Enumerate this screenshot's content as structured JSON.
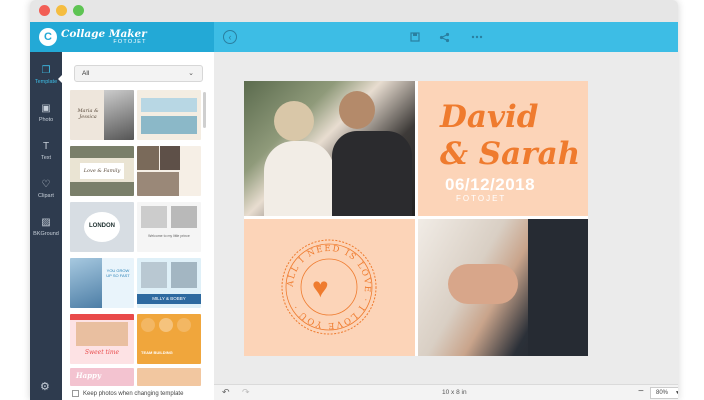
{
  "app": {
    "logo_main": "Collage Maker",
    "logo_sub": "FOTOJET",
    "logo_mark": "C"
  },
  "topbar": {
    "back_icon": "back-arrow-icon",
    "save_icon": "save-icon",
    "share_icon": "share-icon",
    "more_icon": "more-icon"
  },
  "sidebar": {
    "items": [
      {
        "id": "template",
        "label": "Template",
        "glyph": "❐"
      },
      {
        "id": "photo",
        "label": "Photo",
        "glyph": "▣"
      },
      {
        "id": "text",
        "label": "Text",
        "glyph": "T"
      },
      {
        "id": "clipart",
        "label": "Clipart",
        "glyph": "♡"
      },
      {
        "id": "bkground",
        "label": "BKGround",
        "glyph": "▨"
      }
    ],
    "settings_glyph": "⚙"
  },
  "panel": {
    "filter_value": "All",
    "keep_photos_label": "Keep photos when changing template",
    "template_texts": {
      "t1": "Maria & Jessica",
      "t4": "Love & Family",
      "t5": "LONDON",
      "t6": "Welcome to my little prince",
      "t7": "YOU GROW UP SO FAST",
      "t8": "MILLY & BOBBY",
      "t9": "Sweet time",
      "t11": "Happy",
      "t10": "TEAM BUILDING"
    }
  },
  "design": {
    "name_line1": "David",
    "name_line2": "& Sarah",
    "date": "06/12/2018",
    "brand": "FOTOJET",
    "ring_text": "ALL I NEED IS LOVE · I LOVE YOU ·"
  },
  "bottombar": {
    "undo_icon": "undo-icon",
    "redo_icon": "redo-icon",
    "canvas_size": "10 x 8 in",
    "zoom": "80%",
    "zoom_minus": "−",
    "zoom_plus": "+"
  },
  "colors": {
    "accent": "#3dbde5",
    "sidebar": "#2e3b4e",
    "peach": "#fcd4b8",
    "orange": "#ef7b2e"
  }
}
